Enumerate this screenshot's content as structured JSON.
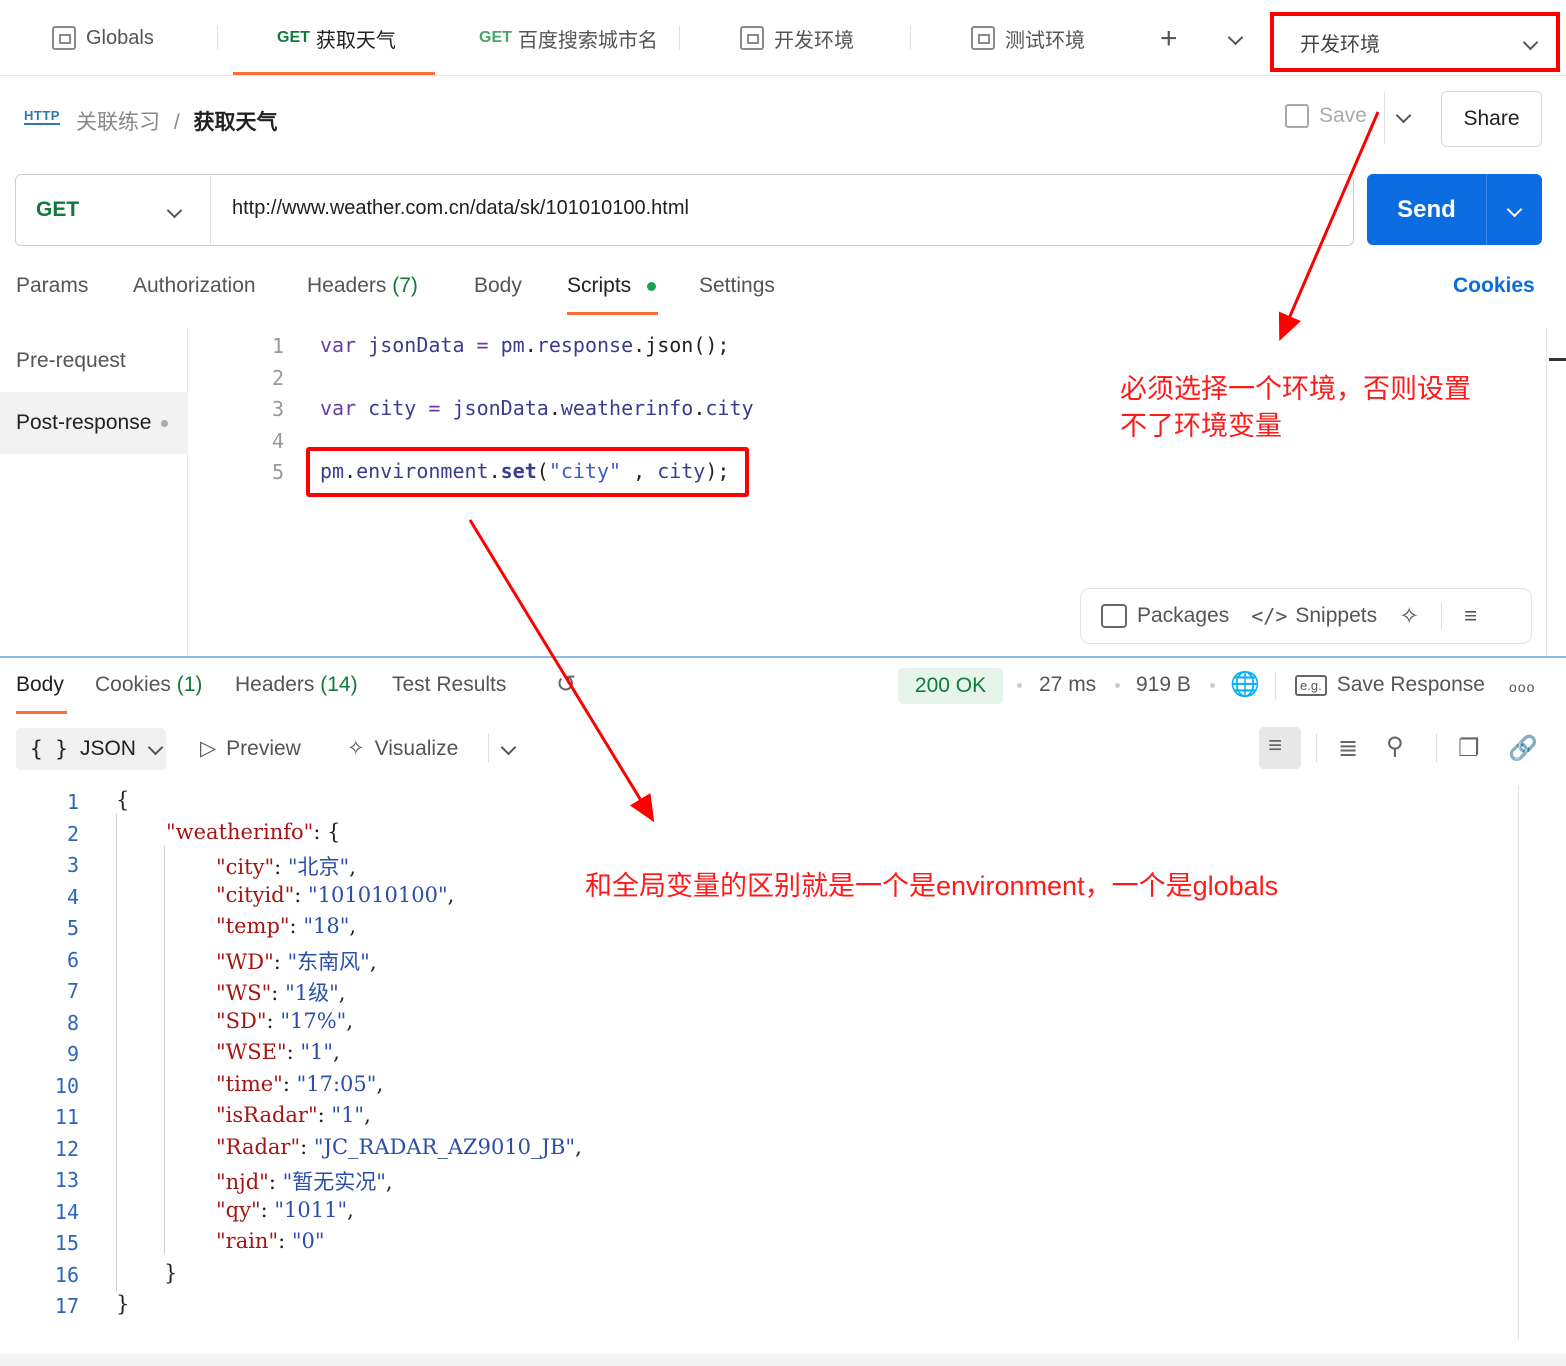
{
  "tabs": [
    {
      "kind": "env",
      "label": "Globals"
    },
    {
      "kind": "request",
      "method": "GET",
      "label": "获取天气",
      "active": true
    },
    {
      "kind": "request",
      "method": "GET",
      "label": "百度搜索城市名"
    },
    {
      "kind": "env",
      "label": "开发环境"
    },
    {
      "kind": "env",
      "label": "测试环境"
    }
  ],
  "new_tab": "+",
  "environment_selector": {
    "value": "开发环境"
  },
  "breadcrumb": {
    "icon": "HTTP",
    "collection": "关联练习",
    "separator": "/",
    "request": "获取天气"
  },
  "toolbar": {
    "save_label": "Save",
    "share_label": "Share"
  },
  "request": {
    "method": "GET",
    "url": "http://www.weather.com.cn/data/sk/101010100.html",
    "send_label": "Send"
  },
  "request_tabs": {
    "params": "Params",
    "authorization": "Authorization",
    "headers": "Headers",
    "headers_count": "(7)",
    "body": "Body",
    "scripts": "Scripts",
    "settings": "Settings",
    "cookies": "Cookies"
  },
  "script_sidebar": {
    "pre_request": "Pre-request",
    "post_response": "Post-response"
  },
  "script_lines": [
    {
      "n": "1"
    },
    {
      "n": "2"
    },
    {
      "n": "3"
    },
    {
      "n": "4"
    },
    {
      "n": "5"
    }
  ],
  "script_tokens": {
    "l1": {
      "kw": "var",
      "var": "jsonData",
      "op": "=",
      "obj": "pm",
      "p1": ".",
      "prop": "response",
      "p2": ".",
      "fn": "json",
      "end": "();"
    },
    "l3": {
      "kw": "var",
      "var": "city",
      "op": "=",
      "obj": "jsonData",
      "p1": ".",
      "prop": "weatherinfo",
      "p2": ".",
      "fn": "city"
    },
    "l5": {
      "obj": "pm",
      "p1": ".",
      "prop": "environment",
      "p2": ".",
      "fn": "set",
      "open": "(",
      "str": "\"city\"",
      "comma": " , ",
      "arg": "city",
      "end": ");"
    }
  },
  "script_tools": {
    "packages": "Packages",
    "snippets": "Snippets"
  },
  "response_tabs": {
    "body": "Body",
    "cookies": "Cookies",
    "cookies_count": "(1)",
    "headers": "Headers",
    "headers_count": "(14)",
    "test_results": "Test Results"
  },
  "response_meta": {
    "status": "200 OK",
    "time": "27 ms",
    "size": "919 B",
    "save_response": "Save Response",
    "more": "ooo"
  },
  "response_format": {
    "format": "JSON",
    "preview": "Preview",
    "visualize": "Visualize"
  },
  "json_lines": [
    {
      "n": "1",
      "open": "{"
    },
    {
      "n": "2",
      "key": "\"weatherinfo\"",
      "colon": ": ",
      "open": "{"
    },
    {
      "n": "3",
      "key": "\"city\"",
      "colon": ": ",
      "val": "\"北京\"",
      "comma": ","
    },
    {
      "n": "4",
      "key": "\"cityid\"",
      "colon": ": ",
      "val": "\"101010100\"",
      "comma": ","
    },
    {
      "n": "5",
      "key": "\"temp\"",
      "colon": ": ",
      "val": "\"18\"",
      "comma": ","
    },
    {
      "n": "6",
      "key": "\"WD\"",
      "colon": ": ",
      "val": "\"东南风\"",
      "comma": ","
    },
    {
      "n": "7",
      "key": "\"WS\"",
      "colon": ": ",
      "val": "\"1级\"",
      "comma": ","
    },
    {
      "n": "8",
      "key": "\"SD\"",
      "colon": ": ",
      "val": "\"17%\"",
      "comma": ","
    },
    {
      "n": "9",
      "key": "\"WSE\"",
      "colon": ": ",
      "val": "\"1\"",
      "comma": ","
    },
    {
      "n": "10",
      "key": "\"time\"",
      "colon": ": ",
      "val": "\"17:05\"",
      "comma": ","
    },
    {
      "n": "11",
      "key": "\"isRadar\"",
      "colon": ": ",
      "val": "\"1\"",
      "comma": ","
    },
    {
      "n": "12",
      "key": "\"Radar\"",
      "colon": ": ",
      "val": "\"JC_RADAR_AZ9010_JB\"",
      "comma": ","
    },
    {
      "n": "13",
      "key": "\"njd\"",
      "colon": ": ",
      "val": "\"暂无实况\"",
      "comma": ","
    },
    {
      "n": "14",
      "key": "\"qy\"",
      "colon": ": ",
      "val": "\"1011\"",
      "comma": ","
    },
    {
      "n": "15",
      "key": "\"rain\"",
      "colon": ": ",
      "val": "\"0\"",
      "comma": ""
    },
    {
      "n": "16",
      "open": "}"
    },
    {
      "n": "17",
      "open": "}"
    }
  ],
  "annotations": {
    "env_note_line1": "必须选择一个环境，否则设置",
    "env_note_line2": "不了环境变量",
    "diff_note": "和全局变量的区别就是一个是environment，一个是globals"
  },
  "colors": {
    "accent": "#ff6c37",
    "send": "#0a6ce0",
    "annotation": "#ff0000",
    "get": "#0f7b3a"
  }
}
